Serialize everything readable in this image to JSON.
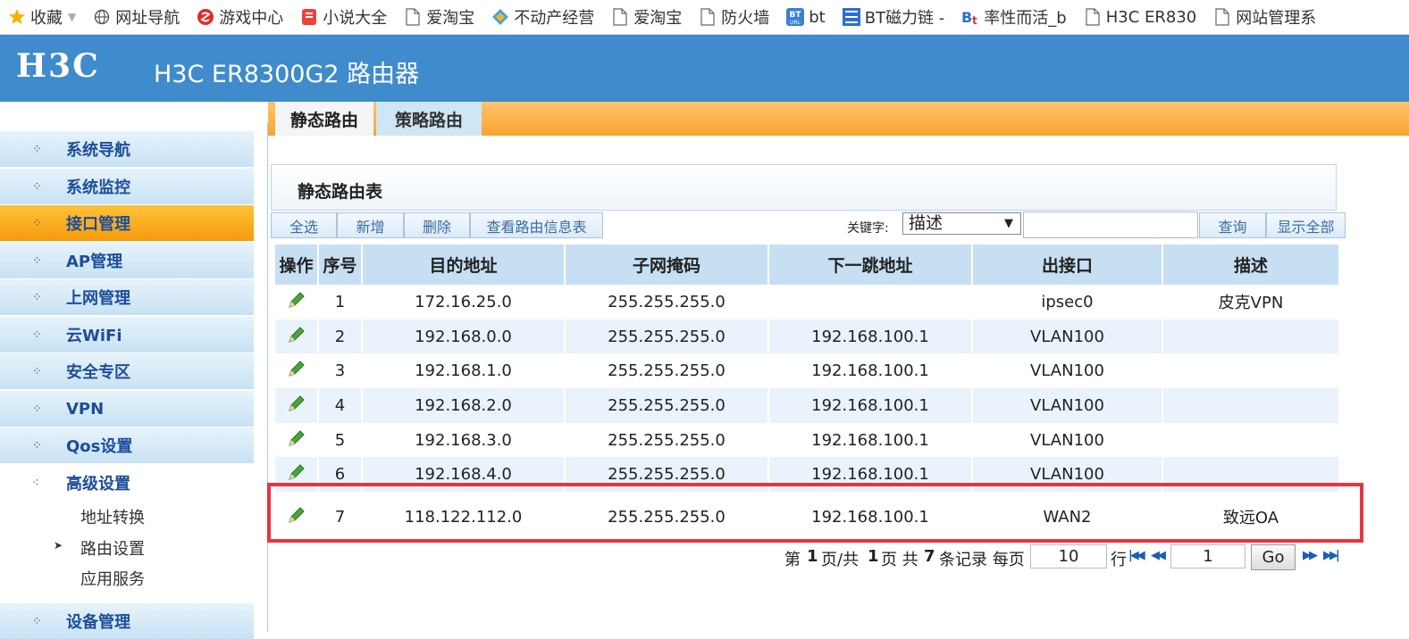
{
  "bookmarks": [
    {
      "label": "收藏",
      "icon": "star-icon"
    },
    {
      "label": "网址导航",
      "icon": "globe-icon"
    },
    {
      "label": "游戏中心",
      "icon": "game-icon"
    },
    {
      "label": "小说大全",
      "icon": "book-icon"
    },
    {
      "label": "爱淘宝",
      "icon": "page-icon"
    },
    {
      "label": "不动产经营",
      "icon": "diamond-icon"
    },
    {
      "label": "爱淘宝",
      "icon": "page-icon"
    },
    {
      "label": "防火墙",
      "icon": "page-icon"
    },
    {
      "label": "bt",
      "icon": "bt-icon"
    },
    {
      "label": "BT磁力链 -",
      "icon": "magnet-icon"
    },
    {
      "label": "率性而活_b",
      "icon": "bt-letter-icon"
    },
    {
      "label": "H3C ER830",
      "icon": "page-icon"
    },
    {
      "label": "网站管理系",
      "icon": "page-icon"
    }
  ],
  "header": {
    "logo": "H3C",
    "title": "H3C ER8300G2 路由器",
    "color": "#3f8bcb"
  },
  "sidebar": {
    "items": [
      {
        "label": "系统导航"
      },
      {
        "label": "系统监控"
      },
      {
        "label": "接口管理"
      },
      {
        "label": "AP管理"
      },
      {
        "label": "上网管理"
      },
      {
        "label": "云WiFi"
      },
      {
        "label": "安全专区"
      },
      {
        "label": "VPN"
      },
      {
        "label": "Qos设置"
      },
      {
        "label": "高级设置"
      },
      {
        "label": "设备管理"
      }
    ],
    "submenu": [
      {
        "label": "地址转换"
      },
      {
        "label": "路由设置"
      },
      {
        "label": "应用服务"
      }
    ]
  },
  "tabs": [
    {
      "label": "静态路由"
    },
    {
      "label": "策略路由"
    }
  ],
  "panel": {
    "title": "静态路由表"
  },
  "toolbar": {
    "select_all": "全选",
    "add": "新增",
    "delete": "删除",
    "view_table": "查看路由信息表",
    "keyword_label": "关键字:",
    "keyword_select": "描述",
    "query": "查询",
    "show_all": "显示全部"
  },
  "table": {
    "headers": [
      "操作",
      "序号",
      "目的地址",
      "子网掩码",
      "下一跳地址",
      "出接口",
      "描述"
    ],
    "rows": [
      {
        "no": "1",
        "dest": "172.16.25.0",
        "mask": "255.255.255.0",
        "nexthop": "",
        "iface": "ipsec0",
        "desc": "皮克VPN"
      },
      {
        "no": "2",
        "dest": "192.168.0.0",
        "mask": "255.255.255.0",
        "nexthop": "192.168.100.1",
        "iface": "VLAN100",
        "desc": ""
      },
      {
        "no": "3",
        "dest": "192.168.1.0",
        "mask": "255.255.255.0",
        "nexthop": "192.168.100.1",
        "iface": "VLAN100",
        "desc": ""
      },
      {
        "no": "4",
        "dest": "192.168.2.0",
        "mask": "255.255.255.0",
        "nexthop": "192.168.100.1",
        "iface": "VLAN100",
        "desc": ""
      },
      {
        "no": "5",
        "dest": "192.168.3.0",
        "mask": "255.255.255.0",
        "nexthop": "192.168.100.1",
        "iface": "VLAN100",
        "desc": ""
      },
      {
        "no": "6",
        "dest": "192.168.4.0",
        "mask": "255.255.255.0",
        "nexthop": "192.168.100.1",
        "iface": "VLAN100",
        "desc": ""
      },
      {
        "no": "7",
        "dest": "118.122.112.0",
        "mask": "255.255.255.0",
        "nexthop": "192.168.100.1",
        "iface": "WAN2",
        "desc": "致远OA"
      }
    ]
  },
  "pager": {
    "p1": "第",
    "current": "1",
    "p2": "页/共",
    "total": "1",
    "p3": "页 共",
    "count": "7",
    "p4": "条记录 每页",
    "page_size": "10",
    "p5": "行",
    "page_input": "1",
    "go": "Go"
  },
  "colors": {
    "accent": "#3f8bcb",
    "tab_orange": "#f8a431",
    "highlight": "#e8343f"
  }
}
